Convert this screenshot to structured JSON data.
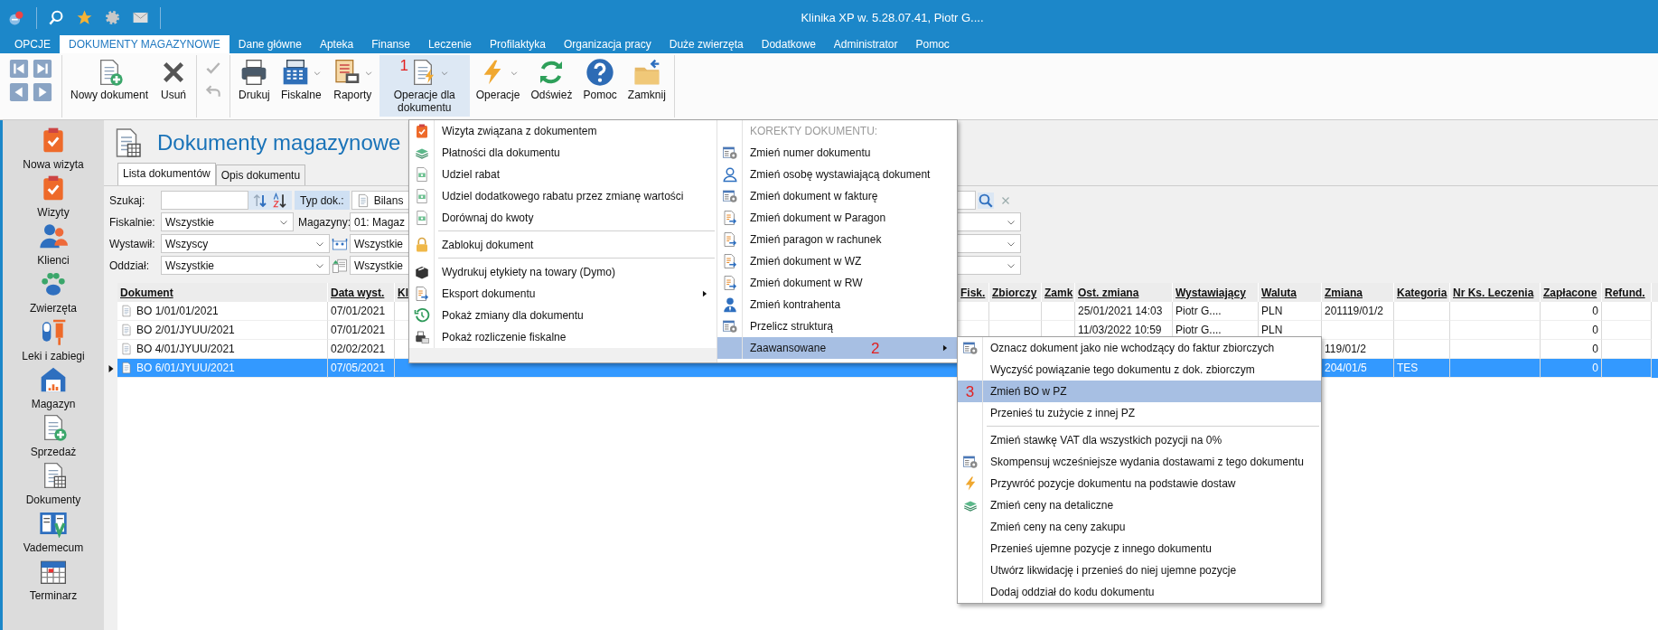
{
  "window": {
    "title": "Klinika XP w. 5.28.07.41, Piotr G...."
  },
  "menu_tabs": [
    {
      "label": "OPCJE",
      "selected": false
    },
    {
      "label": "DOKUMENTY MAGAZYNOWE",
      "selected": true
    },
    {
      "label": "Dane główne",
      "selected": false
    },
    {
      "label": "Apteka",
      "selected": false
    },
    {
      "label": "Finanse",
      "selected": false
    },
    {
      "label": "Leczenie",
      "selected": false
    },
    {
      "label": "Profilaktyka",
      "selected": false
    },
    {
      "label": "Organizacja pracy",
      "selected": false
    },
    {
      "label": "Duże zwierzęta",
      "selected": false
    },
    {
      "label": "Dodatkowe",
      "selected": false
    },
    {
      "label": "Administrator",
      "selected": false
    },
    {
      "label": "Pomoc",
      "selected": false
    }
  ],
  "ribbon": {
    "buttons": [
      {
        "label": "Nowy dokument",
        "dropdown": false,
        "open": false
      },
      {
        "label": "Usuń",
        "dropdown": false,
        "open": false
      },
      {
        "label": "Drukuj",
        "dropdown": false,
        "open": false
      },
      {
        "label": "Fiskalne",
        "dropdown": true,
        "open": false
      },
      {
        "label": "Raporty",
        "dropdown": true,
        "open": false
      },
      {
        "label": "Operacje dla dokumentu",
        "dropdown": true,
        "open": true,
        "marker": "1"
      },
      {
        "label": "Operacje",
        "dropdown": true,
        "open": false
      },
      {
        "label": "Odśwież",
        "dropdown": false,
        "open": false
      },
      {
        "label": "Pomoc",
        "dropdown": false,
        "open": false
      },
      {
        "label": "Zamknij",
        "dropdown": false,
        "open": false
      }
    ]
  },
  "sidebar": {
    "items": [
      {
        "label": "Nowa wizyta"
      },
      {
        "label": "Wizyty"
      },
      {
        "label": "Klienci"
      },
      {
        "label": "Zwierzęta"
      },
      {
        "label": "Leki i zabiegi"
      },
      {
        "label": "Magazyn"
      },
      {
        "label": "Sprzedaż"
      },
      {
        "label": "Dokumenty"
      },
      {
        "label": "Vademecum"
      },
      {
        "label": "Terminarz"
      }
    ]
  },
  "page": {
    "title": "Dokumenty magazynowe",
    "tabs": [
      {
        "label": "Lista dokumentów",
        "selected": true
      },
      {
        "label": "Opis dokumentu",
        "selected": false
      }
    ]
  },
  "filters": {
    "search_label": "Szukaj:",
    "type_label": "Typ dok.:",
    "type_value": "Bilans",
    "rows": [
      {
        "label": "Fiskalnie:",
        "value": "Wszystkie",
        "label_2": "Magazyny:",
        "value_2": "01: Magaz"
      },
      {
        "label": "Wystawił:",
        "value": "Wszyscy",
        "value_2": "Wszystkie"
      },
      {
        "label": "Oddział:",
        "value": "Wszystkie",
        "value_2": "Wszystkie"
      }
    ]
  },
  "table": {
    "columns": [
      "Dokument",
      "Data wyst.",
      "Kl",
      "Fisk.",
      "Zbiorczy",
      "Zamk",
      "Ost. zmiana",
      "Wystawiający",
      "Waluta",
      "Zmiana",
      "Kategoria",
      "Nr Ks. Leczenia",
      "Zapłacone",
      "Refund."
    ],
    "rows": [
      {
        "selected": false,
        "cells": [
          "BO 1/01/01/2021",
          "07/01/2021",
          null,
          null,
          null,
          null,
          "25/01/2021 14:03",
          "Piotr G....",
          "PLN",
          "201119/01/2",
          null,
          null,
          "0",
          null
        ]
      },
      {
        "selected": false,
        "cells": [
          "BO 2/01/JYUU/2021",
          "07/01/2021",
          null,
          null,
          null,
          null,
          "11/03/2022 10:59",
          "Piotr G....",
          "PLN",
          null,
          null,
          null,
          "0",
          null
        ]
      },
      {
        "selected": false,
        "cells": [
          "BO 4/01/JYUU/2021",
          "02/02/2021",
          null,
          null,
          null,
          null,
          null,
          null,
          null,
          "119/01/2",
          null,
          null,
          "0",
          null
        ]
      },
      {
        "selected": true,
        "cells": [
          "BO 6/01/JYUU/2021",
          "07/05/2021",
          null,
          null,
          null,
          null,
          null,
          null,
          null,
          "204/01/5",
          "TES",
          null,
          "0",
          null
        ]
      }
    ]
  },
  "operations_menu": {
    "items": [
      {
        "kind": "item",
        "label": "Wizyta związana z dokumentem",
        "submenu": false
      },
      {
        "kind": "item",
        "label": "Płatności dla dokumentu",
        "submenu": false
      },
      {
        "kind": "item",
        "label": "Udziel rabat",
        "submenu": false
      },
      {
        "kind": "item",
        "label": "Udziel dodatkowego rabatu przez zmianę wartości",
        "submenu": false
      },
      {
        "kind": "item",
        "label": "Dorównaj do kwoty",
        "submenu": false
      },
      {
        "kind": "separator"
      },
      {
        "kind": "item",
        "label": "Zablokuj dokument",
        "submenu": false
      },
      {
        "kind": "separator"
      },
      {
        "kind": "item",
        "label": "Wydrukuj etykiety na towary (Dymo)",
        "submenu": false
      },
      {
        "kind": "item",
        "label": "Eksport dokumentu",
        "submenu": true
      },
      {
        "kind": "item",
        "label": "Pokaż zmiany dla dokumentu",
        "submenu": false
      },
      {
        "kind": "item",
        "label": "Pokaż rozliczenie fiskalne",
        "submenu": false
      }
    ],
    "corrections": {
      "header": "KOREKTY DOKUMENTU:",
      "items": [
        {
          "label": "Zmień numer dokumentu",
          "selected": false,
          "submenu": false
        },
        {
          "label": "Zmień osobę wystawiającą dokument",
          "selected": false,
          "submenu": false
        },
        {
          "label": "Zmień dokument w fakturę",
          "selected": false,
          "submenu": false
        },
        {
          "label": "Zmień dokument w Paragon",
          "selected": false,
          "submenu": false
        },
        {
          "label": "Zmień paragon w rachunek",
          "selected": false,
          "submenu": false
        },
        {
          "label": "Zmień dokument w WZ",
          "selected": false,
          "submenu": false
        },
        {
          "label": "Zmień dokument w RW",
          "selected": false,
          "submenu": false
        },
        {
          "label": "Zmień kontrahenta",
          "selected": false,
          "submenu": false
        },
        {
          "label": "Przelicz strukturą",
          "selected": false,
          "submenu": false
        },
        {
          "label": "Zaawansowane",
          "selected": true,
          "submenu": true,
          "marker": "2"
        }
      ]
    }
  },
  "advanced_menu": {
    "items": [
      {
        "kind": "item",
        "label": "Oznacz dokument jako nie wchodzący do faktur zbiorczych",
        "selected": false
      },
      {
        "kind": "item",
        "label": "Wyczyść powiązanie tego dokumentu z dok. zbiorczym",
        "selected": false
      },
      {
        "kind": "item",
        "label": "Zmień BO w PZ",
        "selected": true,
        "marker": "3"
      },
      {
        "kind": "item",
        "label": "Przenieś tu zużycie z innej PZ",
        "selected": false
      },
      {
        "kind": "separator"
      },
      {
        "kind": "item",
        "label": "Zmień stawkę VAT dla wszystkich pozycji na 0%",
        "selected": false
      },
      {
        "kind": "item",
        "label": "Skompensuj wcześniejsze wydania dostawami z tego dokumentu",
        "selected": false
      },
      {
        "kind": "item",
        "label": "Przywróć pozycje dokumentu na podstawie dostaw",
        "selected": false
      },
      {
        "kind": "item",
        "label": "Zmień ceny na detaliczne",
        "selected": false
      },
      {
        "kind": "item",
        "label": "Zmień ceny na ceny zakupu",
        "selected": false
      },
      {
        "kind": "item",
        "label": "Przenieś ujemne pozycje z innego dokumentu",
        "selected": false
      },
      {
        "kind": "item",
        "label": "Utwórz likwidację i przenieś do niej ujemne pozycje",
        "selected": false
      },
      {
        "kind": "item",
        "label": "Dodaj oddział do kodu dokumentu",
        "selected": false
      }
    ]
  }
}
